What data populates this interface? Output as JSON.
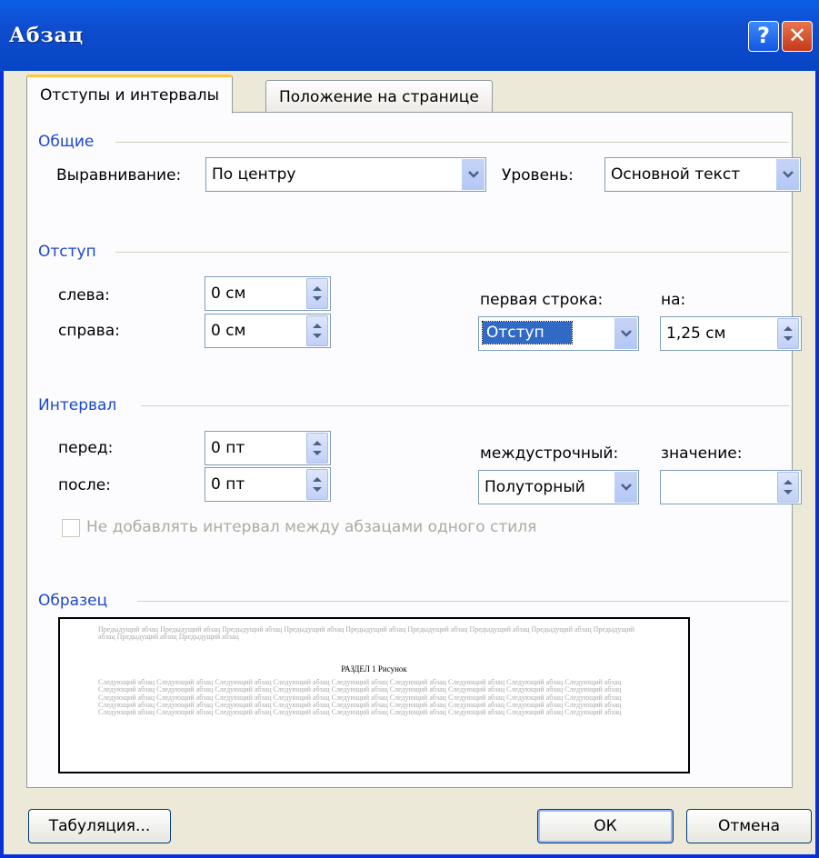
{
  "window": {
    "title": "Абзац",
    "help_label": "?",
    "close_label": "✕"
  },
  "tabs": [
    {
      "label": "Отступы и интервалы"
    },
    {
      "label": "Положение на странице"
    }
  ],
  "general": {
    "section": "Общие",
    "alignment_label": "Выравнивание:",
    "alignment_value": "По центру",
    "level_label": "Уровень:",
    "level_value": "Основной текст"
  },
  "indent": {
    "section": "Отступ",
    "left_label": "слева:",
    "left_value": "0 см",
    "right_label": "справа:",
    "right_value": "0 см",
    "first_line_label": "первая строка:",
    "first_line_value": "Отступ",
    "by_label": "на:",
    "by_value": "1,25 см"
  },
  "spacing": {
    "section": "Интервал",
    "before_label": "перед:",
    "before_value": "0 пт",
    "after_label": "после:",
    "after_value": "0 пт",
    "line_label": "междустрочный:",
    "line_value": "Полуторный",
    "value_label": "значение:",
    "value_value": "",
    "no_space_checkbox_label": "Не добавлять интервал между абзацами одного стиля"
  },
  "sample": {
    "section": "Образец",
    "previous_text": "Предыдущий абзац Предыдущий абзац Предыдущий абзац Предыдущий абзац Предыдущий абзац Предыдущий абзац Предыдущий абзац Предыдущий абзац Предыдущий абзац Предыдущий абзац Предыдущий абзац",
    "main_text": "РАЗДЕЛ 1 Рисунок",
    "next_text": "Следующий абзац Следующий абзац Следующий абзац Следующий абзац Следующий абзац Следующий абзац Следующий абзац Следующий абзац Следующий абзац Следующий абзац Следующий абзац Следующий абзац Следующий абзац Следующий абзац Следующий абзац Следующий абзац Следующий абзац Следующий абзац Следующий абзац Следующий абзац Следующий абзац Следующий абзац Следующий абзац Следующий абзац Следующий абзац Следующий абзац Следующий абзац Следующий абзац Следующий абзац Следующий абзац Следующий абзац Следующий абзац Следующий абзац Следующий абзац Следующий абзац Следующий абзац Следующий абзац Следующий абзац Следующий абзац Следующий абзац Следующий абзац Следующий абзац Следующий абзац Следующий абзац Следующий абзац"
  },
  "buttons": {
    "tabs_label": "Табуляция...",
    "ok_label": "ОК",
    "cancel_label": "Отмена"
  },
  "colors": {
    "accent": "#1c47ce",
    "titlebar": "#0a5fe6",
    "selection": "#316ac5"
  }
}
